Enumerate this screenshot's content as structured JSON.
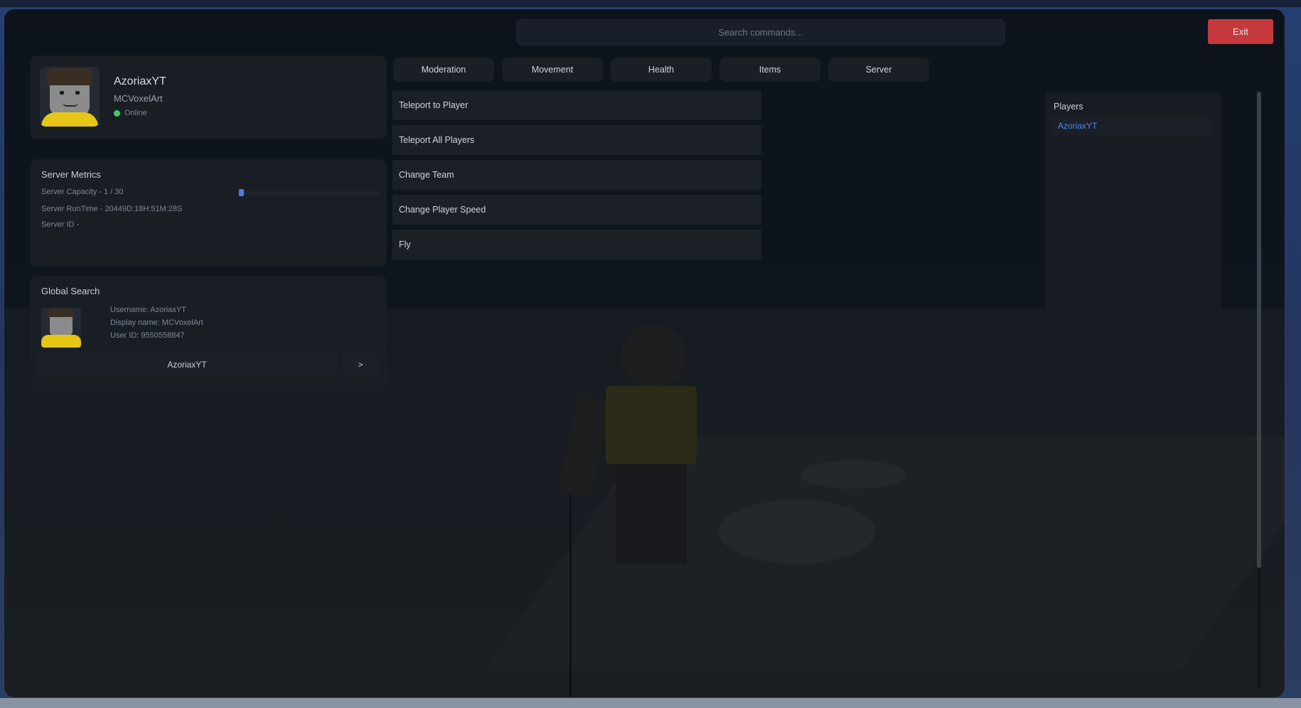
{
  "search": {
    "placeholder": "Search commands..."
  },
  "exit_label": "Exit",
  "profile": {
    "username": "AzoriaxYT",
    "display_name": "MCVoxelArt",
    "status": "Online",
    "status_color": "#3bd169"
  },
  "metrics": {
    "title": "Server Metrics",
    "capacity": "Server Capacity - 1 / 30",
    "capacity_fraction": 0.0333,
    "runtime": "Server RunTime - 20449D:18H:51M:28S",
    "server_id": "Server ID -"
  },
  "global_search": {
    "title": "Global Search",
    "username_line": "Username: AzoriaxYT",
    "display_line": "Display name: MCVoxelArt",
    "user_id_line": "User ID: 9550558847",
    "input_value": "AzoriaxYT",
    "go_label": ">"
  },
  "tabs": [
    {
      "label": "Moderation"
    },
    {
      "label": "Movement"
    },
    {
      "label": "Health"
    },
    {
      "label": "Items"
    },
    {
      "label": "Server"
    }
  ],
  "commands": [
    {
      "label": "Teleport to Player"
    },
    {
      "label": "Teleport All Players"
    },
    {
      "label": "Change Team"
    },
    {
      "label": "Change Player Speed"
    },
    {
      "label": "Fly"
    }
  ],
  "players_panel": {
    "title": "Players",
    "items": [
      {
        "name": "AzoriaxYT"
      }
    ]
  },
  "colors": {
    "accent": "#4a7df0",
    "exit": "#c5393d",
    "player_link": "#4d86f1"
  }
}
